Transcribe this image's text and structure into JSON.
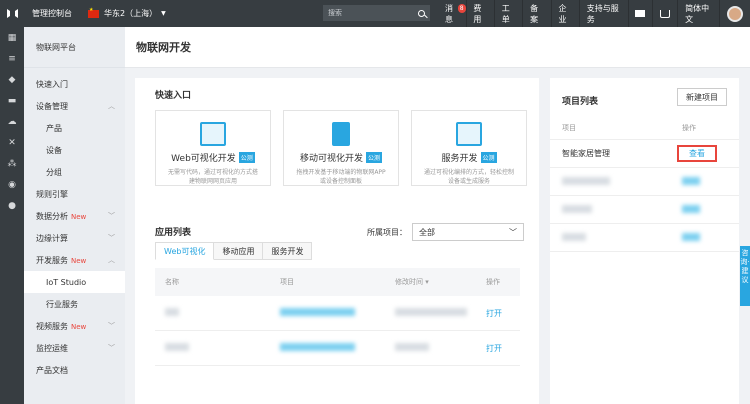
{
  "topbar": {
    "console": "管理控制台",
    "region": "华东2（上海）",
    "search_placeholder": "搜索",
    "nav": [
      {
        "label": "消息",
        "badge": "8"
      },
      {
        "label": "费用"
      },
      {
        "label": "工单"
      },
      {
        "label": "备案"
      },
      {
        "label": "企业"
      },
      {
        "label": "支持与服务"
      }
    ],
    "language": "简体中文"
  },
  "sidebar": {
    "title": "物联网平台",
    "items": [
      {
        "label": "快速入门"
      },
      {
        "label": "设备管理"
      },
      {
        "label": "产品"
      },
      {
        "label": "设备"
      },
      {
        "label": "分组"
      },
      {
        "label": "规则引擎"
      },
      {
        "label": "数据分析",
        "new": "New"
      },
      {
        "label": "边缘计算"
      },
      {
        "label": "开发服务",
        "new": "New"
      },
      {
        "label": "IoT Studio"
      },
      {
        "label": "行业服务"
      },
      {
        "label": "视频服务",
        "new": "New"
      },
      {
        "label": "监控运维"
      },
      {
        "label": "产品文档"
      }
    ]
  },
  "main": {
    "title": "物联网开发",
    "quick_entry": {
      "title": "快速入口",
      "items": [
        {
          "name": "Web可视化开发",
          "tag": "公测",
          "desc": "无需写代码，通过可视化的方式搭建物联网网页应用"
        },
        {
          "name": "移动可视化开发",
          "tag": "公测",
          "desc": "拖拽开发基于移动端的物联网APP或设备控制面板"
        },
        {
          "name": "服务开发",
          "tag": "公测",
          "desc": "通过可视化编排的方式，轻松控制设备或生成服务"
        }
      ]
    },
    "app_list": {
      "title": "应用列表",
      "project_label": "所属项目：",
      "project_value": "全部",
      "tabs": [
        "Web可视化",
        "移动应用",
        "服务开发"
      ],
      "columns": [
        "名称",
        "项目",
        "修改时间 ▾",
        "操作"
      ],
      "rows": [
        {
          "action": "打开"
        },
        {
          "action": "打开"
        }
      ]
    },
    "project_list": {
      "title": "项目列表",
      "new_button": "新建项目",
      "columns": [
        "项目",
        "操作"
      ],
      "rows": [
        {
          "name": "智能家居管理",
          "action": "查看"
        }
      ]
    },
    "float_tab": "咨询·建议"
  }
}
